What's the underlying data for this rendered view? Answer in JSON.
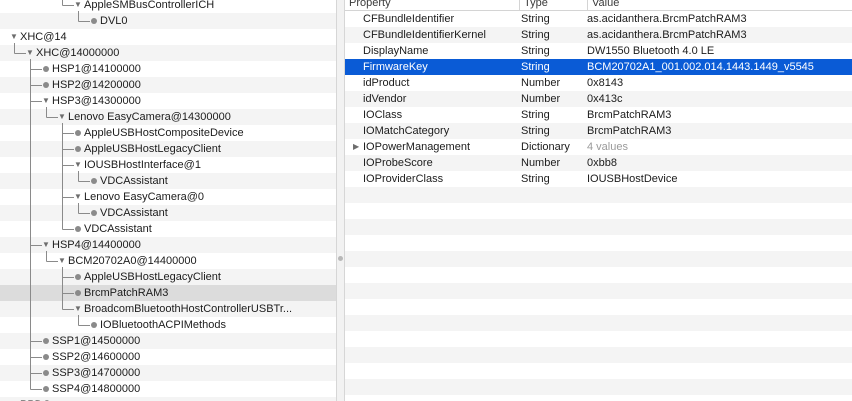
{
  "tree": {
    "rows": [
      {
        "id": "r0",
        "label": "AppleSMBusControllerICH",
        "kind": "expanded",
        "depth": 4
      },
      {
        "id": "r1",
        "label": "DVL0",
        "kind": "leaf",
        "depth": 5
      },
      {
        "id": "r2",
        "label": "XHC@14",
        "kind": "expanded",
        "depth": 0
      },
      {
        "id": "r3",
        "label": "XHC@14000000",
        "kind": "expanded",
        "depth": 1
      },
      {
        "id": "r4",
        "label": "HSP1@14100000",
        "kind": "leaf",
        "depth": 2
      },
      {
        "id": "r5",
        "label": "HSP2@14200000",
        "kind": "leaf",
        "depth": 2
      },
      {
        "id": "r6",
        "label": "HSP3@14300000",
        "kind": "expanded",
        "depth": 2
      },
      {
        "id": "r7",
        "label": "Lenovo EasyCamera@14300000",
        "kind": "expanded",
        "depth": 3
      },
      {
        "id": "r8",
        "label": "AppleUSBHostCompositeDevice",
        "kind": "leaf",
        "depth": 4
      },
      {
        "id": "r9",
        "label": "AppleUSBHostLegacyClient",
        "kind": "leaf",
        "depth": 4
      },
      {
        "id": "r10",
        "label": "IOUSBHostInterface@1",
        "kind": "expanded",
        "depth": 4
      },
      {
        "id": "r11",
        "label": "VDCAssistant",
        "kind": "leaf",
        "depth": 5
      },
      {
        "id": "r12",
        "label": "Lenovo EasyCamera@0",
        "kind": "expanded",
        "depth": 4
      },
      {
        "id": "r13",
        "label": "VDCAssistant",
        "kind": "leaf",
        "depth": 5
      },
      {
        "id": "r14",
        "label": "VDCAssistant",
        "kind": "leaf",
        "depth": 4
      },
      {
        "id": "r15",
        "label": "HSP4@14400000",
        "kind": "expanded",
        "depth": 2
      },
      {
        "id": "r16",
        "label": "BCM20702A0@14400000",
        "kind": "expanded",
        "depth": 3
      },
      {
        "id": "r17",
        "label": "AppleUSBHostLegacyClient",
        "kind": "leaf",
        "depth": 4
      },
      {
        "id": "r18",
        "label": "BrcmPatchRAM3",
        "kind": "leaf",
        "depth": 4,
        "selected": true
      },
      {
        "id": "r19",
        "label": "BroadcomBluetoothHostControllerUSBTr...",
        "kind": "expanded",
        "depth": 4
      },
      {
        "id": "r20",
        "label": "IOBluetoothACPIMethods",
        "kind": "leaf",
        "depth": 5
      },
      {
        "id": "r21",
        "label": "SSP1@14500000",
        "kind": "leaf",
        "depth": 2
      },
      {
        "id": "r22",
        "label": "SSP2@14600000",
        "kind": "leaf",
        "depth": 2
      },
      {
        "id": "r23",
        "label": "SSP3@14700000",
        "kind": "leaf",
        "depth": 2
      },
      {
        "id": "r24",
        "label": "SSP4@14800000",
        "kind": "leaf",
        "depth": 2
      },
      {
        "id": "r25",
        "label": "PPDC",
        "kind": "partial",
        "depth": 0
      }
    ]
  },
  "properties": {
    "headers": {
      "property": "Property",
      "type": "Type",
      "value": "Value"
    },
    "rows": [
      {
        "key": "CFBundleIdentifier",
        "type": "String",
        "value": "as.acidanthera.BrcmPatchRAM3"
      },
      {
        "key": "CFBundleIdentifierKernel",
        "type": "String",
        "value": "as.acidanthera.BrcmPatchRAM3"
      },
      {
        "key": "DisplayName",
        "type": "String",
        "value": "DW1550 Bluetooth 4.0 LE"
      },
      {
        "key": "FirmwareKey",
        "type": "String",
        "value": "BCM20702A1_001.002.014.1443.1449_v5545",
        "selected": true
      },
      {
        "key": "idProduct",
        "type": "Number",
        "value": "0x8143"
      },
      {
        "key": "idVendor",
        "type": "Number",
        "value": "0x413c"
      },
      {
        "key": "IOClass",
        "type": "String",
        "value": "BrcmPatchRAM3"
      },
      {
        "key": "IOMatchCategory",
        "type": "String",
        "value": "BrcmPatchRAM3"
      },
      {
        "key": "IOPowerManagement",
        "type": "Dictionary",
        "value": "4 values",
        "collapsed": true,
        "dim_value": true
      },
      {
        "key": "IOProbeScore",
        "type": "Number",
        "value": "0xbb8"
      },
      {
        "key": "IOProviderClass",
        "type": "String",
        "value": "IOUSBHostDevice"
      }
    ]
  },
  "colors": {
    "selection_blue": "#0a5bd6",
    "selection_gray": "#dcdcdc",
    "row_alt": "#f4f4f4",
    "tree_line": "#8a8a8a"
  }
}
